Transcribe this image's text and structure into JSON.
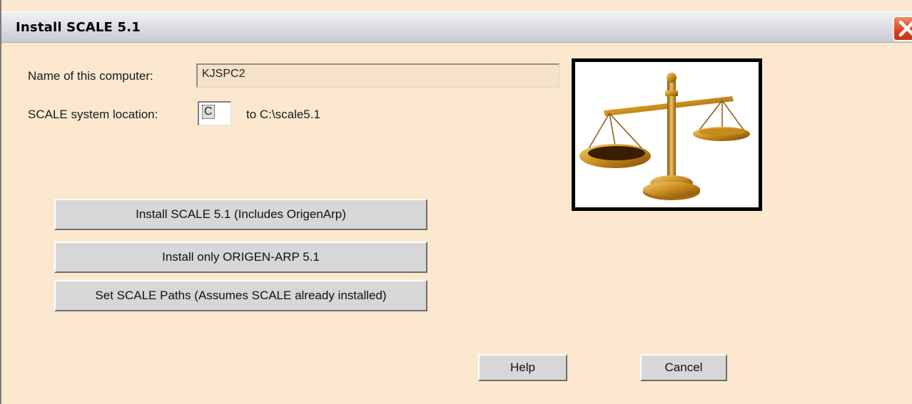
{
  "window": {
    "title": "Install SCALE 5.1"
  },
  "form": {
    "computer_name_label": "Name of this computer:",
    "computer_name_value": "KJSPC2",
    "location_label": "SCALE system location:",
    "drive_value": "C",
    "location_suffix": "to C:\\scale5.1"
  },
  "buttons": {
    "install_scale": "Install SCALE 5.1 (Includes OrigenArp)",
    "install_origen": "Install  only ORIGEN-ARP 5.1",
    "set_paths": "Set SCALE Paths (Assumes SCALE already installed)",
    "help": "Help",
    "cancel": "Cancel"
  },
  "icons": {
    "close": "close-icon",
    "picture": "balance-scale-icon"
  },
  "colors": {
    "window_background": "#fbe8cf",
    "close_button": "#d9431e",
    "button_face": "#d7d7da",
    "scale_gold": "#c98a1c"
  }
}
